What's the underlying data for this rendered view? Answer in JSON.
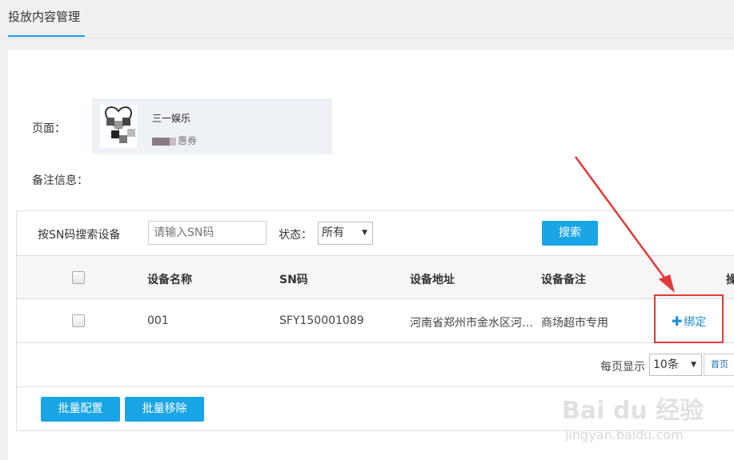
{
  "tabs": [
    {
      "label": "投放内容管理"
    }
  ],
  "page_section": {
    "page_label": "页面：",
    "remark_label": "备注信息：",
    "card": {
      "title": "三一娱乐",
      "subtitle": "惠券"
    }
  },
  "search": {
    "label": "按SN码搜索设备",
    "placeholder": "请输入SN码",
    "status_label": "状态：",
    "status_value": "所有",
    "button": "搜索"
  },
  "table": {
    "columns": [
      "设备名称",
      "SN码",
      "设备地址",
      "设备备注",
      "操"
    ],
    "rows": [
      {
        "name": "001",
        "sn": "SFY150001089",
        "address": "河南省郑州市金水区河…",
        "remark": "商场超市专用",
        "action": "绑定"
      }
    ]
  },
  "pager": {
    "label": "每页显示",
    "page_size": "10条",
    "first": "首页"
  },
  "batch": {
    "config": "批量配置",
    "remove": "批量移除"
  },
  "watermark": {
    "main": "Bai du 经验",
    "sub": "jingyan.baidu.com"
  },
  "colors": {
    "accent": "#1aa6e6",
    "link": "#1a8fd6",
    "annotation": "#e53935"
  }
}
